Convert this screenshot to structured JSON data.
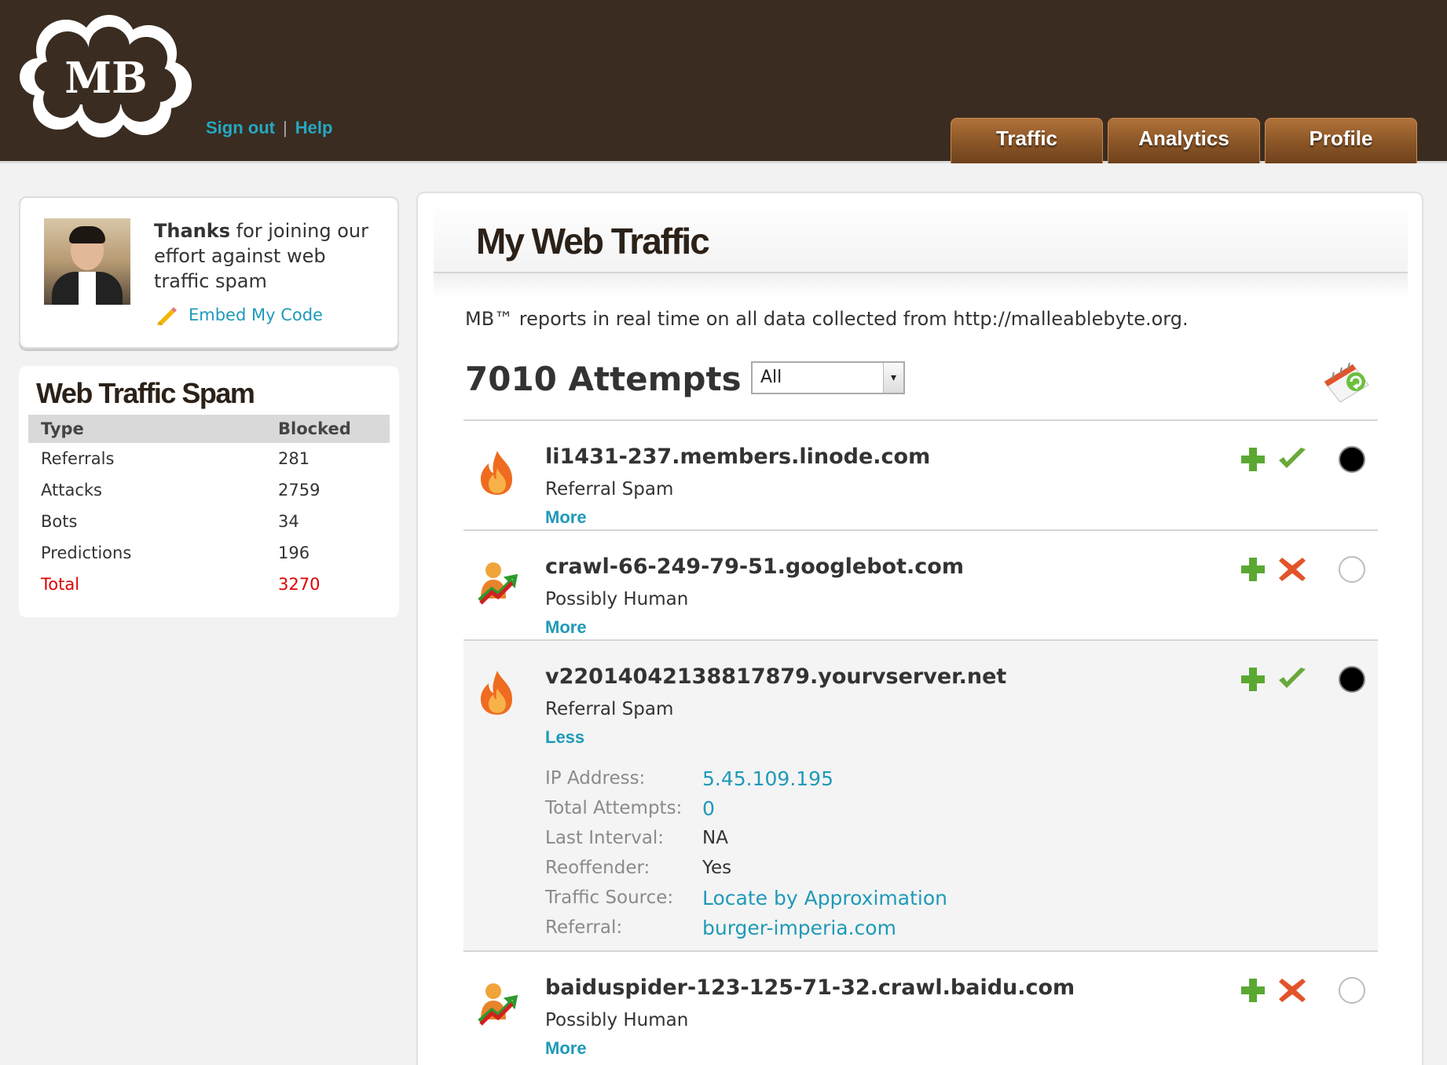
{
  "header": {
    "logo_text": "MB",
    "sign_out": "Sign out",
    "separator": "|",
    "help": "Help",
    "tabs": [
      {
        "label": "Traffic"
      },
      {
        "label": "Analytics"
      },
      {
        "label": "Profile"
      }
    ]
  },
  "profile": {
    "thanks_bold": "Thanks",
    "thanks_rest": " for joining our effort against web traffic spam",
    "embed_label": "Embed My Code"
  },
  "spam": {
    "title": "Web Traffic Spam",
    "col_type": "Type",
    "col_blocked": "Blocked",
    "rows": [
      {
        "type": "Referrals",
        "blocked": "281"
      },
      {
        "type": "Attacks",
        "blocked": "2759"
      },
      {
        "type": "Bots",
        "blocked": "34"
      },
      {
        "type": "Predictions",
        "blocked": "196"
      }
    ],
    "total_label": "Total",
    "total_value": "3270"
  },
  "main": {
    "title": "My Web Traffic",
    "report": "MB™ reports in real time on all data collected from http://malleablebyte.org.",
    "attempts": "7010 Attempts",
    "filter_value": "All",
    "entries": [
      {
        "host": "li1431-237.members.linode.com",
        "kind": "Referral Spam",
        "toggle": "More"
      },
      {
        "host": "crawl-66-249-79-51.googlebot.com",
        "kind": "Possibly Human",
        "toggle": "More"
      },
      {
        "host": "v22014042138817879.yourvserver.net",
        "kind": "Referral Spam",
        "toggle": "Less",
        "details": {
          "ip_label": "IP Address:",
          "ip_value": "5.45.109.195",
          "total_label": "Total Attempts:",
          "total_value": "0",
          "interval_label": "Last Interval:",
          "interval_value": "NA",
          "reoffender_label": "Reoffender:",
          "reoffender_value": "Yes",
          "source_label": "Traffic Source:",
          "source_value": "Locate by Approximation",
          "referral_label": "Referral:",
          "referral_value": "burger-imperia.com"
        }
      },
      {
        "host": "baiduspider-123-125-71-32.crawl.baidu.com",
        "kind": "Possibly Human",
        "toggle": "More"
      }
    ]
  }
}
